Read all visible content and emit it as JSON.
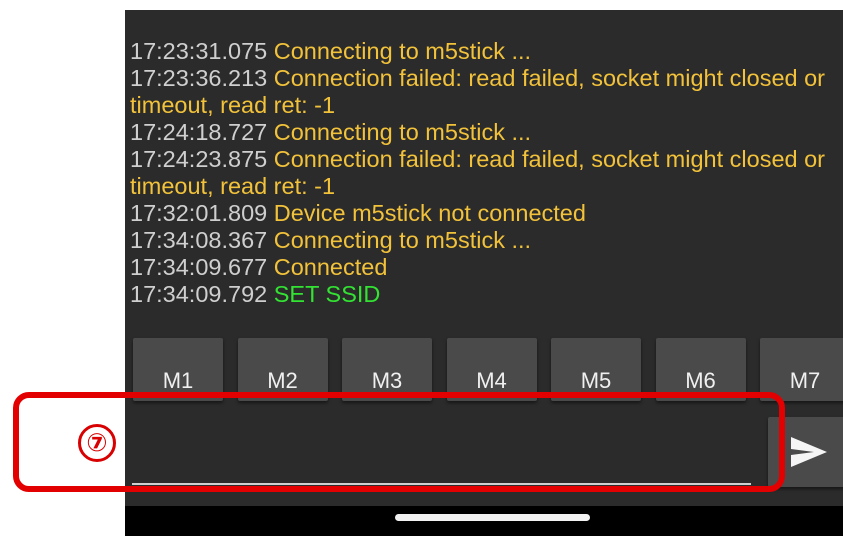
{
  "log": [
    {
      "time": "17:23:31.075",
      "message": "Connecting to m5stick ...",
      "color": "#f2c23a"
    },
    {
      "time": "17:23:36.213",
      "message": "Connection failed: read failed, socket might closed or timeout, read ret: -1",
      "color": "#f2c23a"
    },
    {
      "time": "17:24:18.727",
      "message": "Connecting to m5stick ...",
      "color": "#f2c23a"
    },
    {
      "time": "17:24:23.875",
      "message": "Connection failed: read failed, socket might closed or timeout, read ret: -1",
      "color": "#f2c23a"
    },
    {
      "time": "17:32:01.809",
      "message": "Device m5stick not connected",
      "color": "#f2c23a"
    },
    {
      "time": "17:34:08.367",
      "message": "Connecting to m5stick ...",
      "color": "#f2c23a"
    },
    {
      "time": "17:34:09.677",
      "message": "Connected",
      "color": "#f2c23a"
    },
    {
      "time": "17:34:09.792",
      "message": "SET SSID",
      "color": "#33e233"
    }
  ],
  "macros": [
    "M1",
    "M2",
    "M3",
    "M4",
    "M5",
    "M6",
    "M7"
  ],
  "input": {
    "value": ""
  },
  "send_button": {
    "icon": "send-icon"
  },
  "annotation": {
    "marker": "⑦",
    "color": "#e30000"
  }
}
